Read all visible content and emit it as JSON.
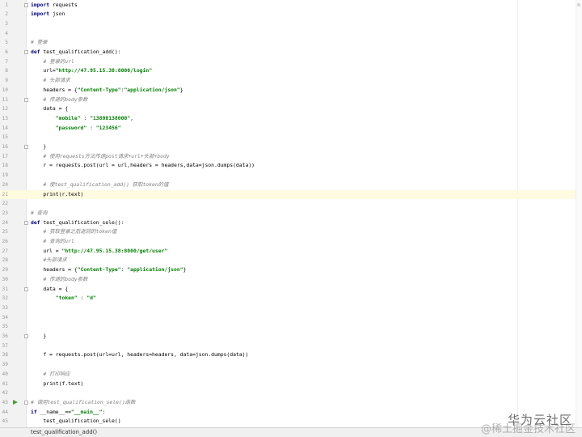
{
  "editor": {
    "current_line": 21,
    "run_line": 43,
    "fold_lines": [
      1,
      6,
      11,
      16,
      24,
      31,
      36,
      43
    ],
    "lines": [
      [
        {
          "t": "import",
          "c": "kw"
        },
        {
          "t": " requests"
        }
      ],
      [
        {
          "t": "import",
          "c": "kw"
        },
        {
          "t": " json"
        }
      ],
      [],
      [],
      [
        {
          "t": "# 登录",
          "c": "cmt"
        }
      ],
      [
        {
          "t": "def",
          "c": "kw"
        },
        {
          "t": " test_qualification_add():"
        }
      ],
      [
        {
          "t": "    "
        },
        {
          "t": "# 登录的url",
          "c": "cmt"
        }
      ],
      [
        {
          "t": "    url="
        },
        {
          "t": "\"http://47.95.15.38:8000/login\"",
          "c": "str"
        }
      ],
      [
        {
          "t": "    "
        },
        {
          "t": "# 头部请求",
          "c": "cmt"
        }
      ],
      [
        {
          "t": "    headers = {"
        },
        {
          "t": "\"Content-Type\"",
          "c": "str"
        },
        {
          "t": ":"
        },
        {
          "t": "\"application/json\"",
          "c": "str"
        },
        {
          "t": "}"
        }
      ],
      [
        {
          "t": "    "
        },
        {
          "t": "# 传递的body参数",
          "c": "cmt"
        }
      ],
      [
        {
          "t": "    data = {"
        }
      ],
      [
        {
          "t": "        "
        },
        {
          "t": "\"mobile\"",
          "c": "str"
        },
        {
          "t": " : "
        },
        {
          "t": "\"13800138000\"",
          "c": "str"
        },
        {
          "t": ","
        }
      ],
      [
        {
          "t": "        "
        },
        {
          "t": "\"password\"",
          "c": "str"
        },
        {
          "t": " : "
        },
        {
          "t": "\"123456\"",
          "c": "str"
        }
      ],
      [],
      [
        {
          "t": "    }"
        }
      ],
      [
        {
          "t": "    "
        },
        {
          "t": "# 使用requests方法传递post请求+url+头部+body",
          "c": "cmt"
        }
      ],
      [
        {
          "t": "    r = requests.post(url = url,headers = headers,data=json.dumps(data))"
        }
      ],
      [],
      [
        {
          "t": "    "
        },
        {
          "t": "# 使test_qualification_add() 获取token的值",
          "c": "cmt"
        }
      ],
      [
        {
          "t": "    print(r.text)"
        }
      ],
      [],
      [
        {
          "t": "# 查询",
          "c": "cmt"
        }
      ],
      [
        {
          "t": "def",
          "c": "kw"
        },
        {
          "t": " test_qualification_sele():"
        }
      ],
      [
        {
          "t": "    "
        },
        {
          "t": "# 获取登录之后返回的token值",
          "c": "cmt"
        }
      ],
      [
        {
          "t": "    "
        },
        {
          "t": "# 查询的url",
          "c": "cmt"
        }
      ],
      [
        {
          "t": "    url = "
        },
        {
          "t": "\"http://47.95.15.38:8000/get/user\"",
          "c": "str"
        }
      ],
      [
        {
          "t": "    "
        },
        {
          "t": "#头部请求",
          "c": "cmt"
        }
      ],
      [
        {
          "t": "    headers = {"
        },
        {
          "t": "\"Content-Type\"",
          "c": "str"
        },
        {
          "t": ": "
        },
        {
          "t": "\"application/json\"",
          "c": "str"
        },
        {
          "t": "}"
        }
      ],
      [
        {
          "t": "    "
        },
        {
          "t": "# 传递的body参数",
          "c": "cmt"
        }
      ],
      [
        {
          "t": "    data = {"
        }
      ],
      [
        {
          "t": "        "
        },
        {
          "t": "\"token\"",
          "c": "str"
        },
        {
          "t": " : "
        },
        {
          "t": "\"d\"",
          "c": "str"
        }
      ],
      [],
      [],
      [],
      [
        {
          "t": "    }"
        }
      ],
      [],
      [
        {
          "t": "    f = requests.post(url=url, headers=headers, data=json.dumps(data))"
        }
      ],
      [],
      [
        {
          "t": "    "
        },
        {
          "t": "# 打印响应",
          "c": "cmt"
        }
      ],
      [
        {
          "t": "    print(f.text)"
        }
      ],
      [],
      [
        {
          "t": "# 调用test_qualification_sele()函数",
          "c": "cmt"
        }
      ],
      [
        {
          "t": "if",
          "c": "kw"
        },
        {
          "t": " __name__=="
        },
        {
          "t": "\"__main__\"",
          "c": "str"
        },
        {
          "t": ":"
        }
      ],
      [
        {
          "t": "    test_qualification_sele()"
        }
      ],
      []
    ]
  },
  "statusbar": {
    "breadcrumb": "test_qualification_add()"
  },
  "watermark": {
    "line1": "华为云社区",
    "line2": "@稀土掘金技术社区"
  }
}
